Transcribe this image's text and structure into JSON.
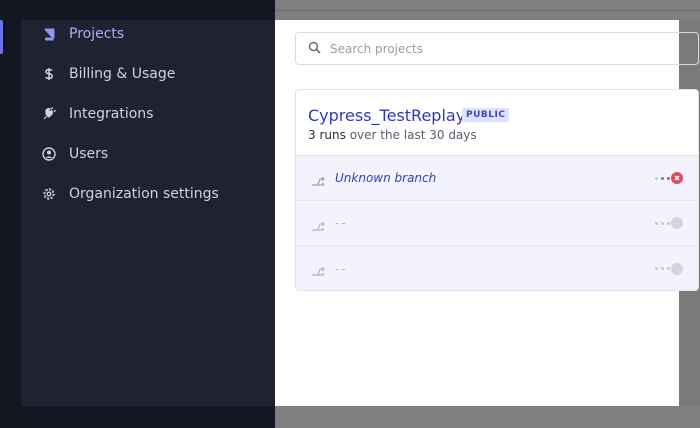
{
  "sidebar": {
    "items": [
      {
        "label": "Projects",
        "icon": "book-icon",
        "active": true
      },
      {
        "label": "Billing & Usage",
        "icon": "dollar-icon",
        "active": false
      },
      {
        "label": "Integrations",
        "icon": "plug-icon",
        "active": false
      },
      {
        "label": "Users",
        "icon": "user-circle-icon",
        "active": false
      },
      {
        "label": "Organization settings",
        "icon": "gear-icon",
        "active": false
      }
    ]
  },
  "search": {
    "placeholder": "Search projects",
    "value": ""
  },
  "project": {
    "name": "Cypress_TestReplay",
    "badge": "PUBLIC",
    "runs_count": "3 runs",
    "runs_period": "over the last 30 days",
    "rows": [
      {
        "branch": "Unknown branch",
        "status": "failed"
      },
      {
        "branch": "--",
        "status": "none"
      },
      {
        "branch": "--",
        "status": "none"
      }
    ]
  },
  "colors": {
    "accent": "#6c75e6",
    "link": "#2f3ab5",
    "fail": "#e14b5e",
    "sidebar_bg": "#1f2231"
  }
}
